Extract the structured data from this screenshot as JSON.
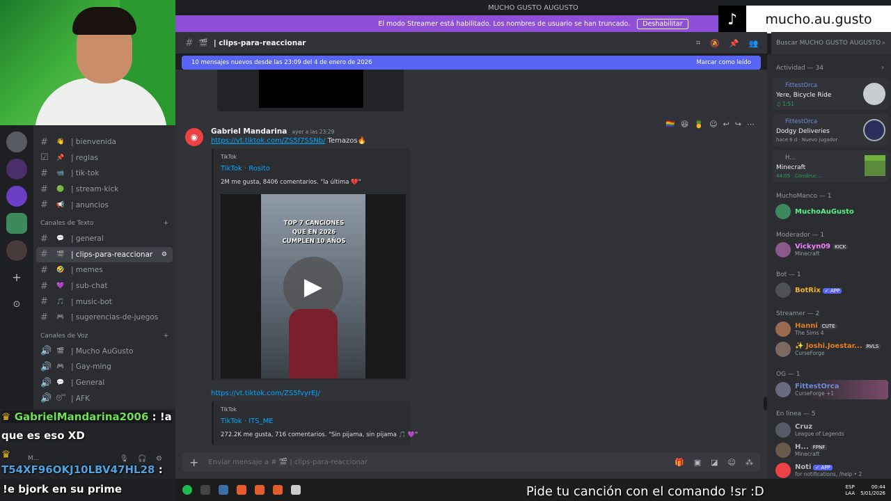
{
  "window": {
    "title": "MUCHO GUSTO AUGUSTO"
  },
  "streamer_banner": {
    "text": "El modo Streamer está habilitado. Los nombres de usuario se han truncado.",
    "button": "Deshabilitar"
  },
  "tiktok_overlay": {
    "handle": "mucho.au.gusto"
  },
  "channel_header": {
    "name": "| clips-para-reaccionar",
    "search_placeholder": "Buscar MUCHO GUSTO AUGUSTO"
  },
  "new_messages_bar": {
    "text": "10 mensajes nuevos desde las 23:09 del 4 de enero de 2026",
    "action": "Marcar como leído"
  },
  "sidebar": {
    "top_channels": [
      {
        "label": "| bienvenida",
        "emoji": "👋"
      },
      {
        "label": "| reglas",
        "emoji": "📌"
      },
      {
        "label": "| tik-tok",
        "emoji": "📹"
      },
      {
        "label": "| stream-kick",
        "emoji": "🟢"
      },
      {
        "label": "| anuncios",
        "emoji": "📢"
      }
    ],
    "text_category": "Canales de Texto",
    "text_channels": [
      {
        "label": "| general",
        "emoji": "💬"
      },
      {
        "label": "| clips-para-reaccionar",
        "emoji": "🎬"
      },
      {
        "label": "| memes",
        "emoji": "🤣"
      },
      {
        "label": "| sub-chat",
        "emoji": "💜"
      },
      {
        "label": "| music-bot",
        "emoji": "🎵"
      },
      {
        "label": "| sugerencias-de-juegos",
        "emoji": "🎮"
      }
    ],
    "voice_category": "Canales de Voz",
    "voice_channels": [
      {
        "label": "| Mucho AuGusto",
        "emoji": "🎬"
      },
      {
        "label": "| Gay-ming",
        "emoji": "🎮"
      },
      {
        "label": "| General",
        "emoji": "💬"
      },
      {
        "label": "| AFK",
        "emoji": "😴"
      }
    ],
    "user_short": "M..."
  },
  "stream_chat": {
    "line1_user": "GabrielMandarina2006",
    "line1_text": ": !a",
    "line1_cont": "que es eso XD",
    "line2_user": "T54XF96OKJ10LBV47HL28",
    "line2_text": ":",
    "line3_text": "!e bjork en su prime"
  },
  "message": {
    "author": "Gabriel Mandarina",
    "time": "ayer a las 23:29",
    "link": "https://vt.tiktok.com/ZS5f7SSNb/",
    "text": "Temazos🔥",
    "embed1": {
      "provider": "TikTok",
      "title": "TikTok · Rosito",
      "desc": "2M me gusta, 8406 comentarios. \"la última 💔\"",
      "video_caption": "TOP 7 CANCIONES QUE EN 2026 CUMPLEN 10 AÑOS"
    },
    "link2": "https://vt.tiktok.com/ZS5fvyrEJ/",
    "embed2": {
      "provider": "TikTok",
      "title": "TikTok · ITS_ME",
      "desc": "272.2K me gusta, 716 comentarios. \"Sin pijama, sin pijama 🎵 💜\""
    }
  },
  "composer": {
    "placeholder": "Enviar mensaje a # 🎬 | clips-para-reaccionar"
  },
  "members": {
    "activity_header": "Actividad — 34",
    "activities": [
      {
        "user": "FittestOrca",
        "title": "Yere, Bicycle Ride",
        "sub": "♫ 1:51"
      },
      {
        "user": "FittestOrca",
        "title": "Dodgy Deliveries",
        "sub": "hace 6 d · Nuevo jugador"
      },
      {
        "user": "H...",
        "title": "Minecraft",
        "sub": "44:05 · Construc..."
      }
    ],
    "groups": [
      {
        "label": "MuchoManco — 1"
      },
      {
        "label": "Moderador — 1"
      },
      {
        "label": "Bot — 1"
      },
      {
        "label": "Streamer — 2"
      },
      {
        "label": "OG — 1"
      },
      {
        "label": "En línea — 5"
      }
    ],
    "list": [
      {
        "name": "MuchoAuGusto",
        "sub": "",
        "badge": "",
        "color": "#57f287"
      },
      {
        "name": "Vickyn09",
        "sub": "Minecraft",
        "badge": "KICK",
        "color": "#f47fff"
      },
      {
        "name": "BotRix",
        "sub": "",
        "badge": "✓ APP",
        "color": "#f0b232"
      },
      {
        "name": "Hanni",
        "sub": "The Sims 4",
        "badge": "CUTE",
        "color": "#e67e22"
      },
      {
        "name": "✨ Joshi.Joestar...",
        "sub": "CurseForge",
        "badge": "RVLS",
        "color": "#e67e22"
      },
      {
        "name": "FittestOrca",
        "sub": "CurseForge +1",
        "badge": "",
        "color": "#7289da"
      },
      {
        "name": "Cruz",
        "sub": "League of Legends",
        "badge": "",
        "color": "#b5bac1"
      },
      {
        "name": "H...",
        "sub": "Minecraft",
        "badge": "FPNF",
        "color": "#b5bac1"
      },
      {
        "name": "Noti",
        "sub": "for notifications, /help • 2",
        "badge": "✓ APP",
        "color": "#b5bac1"
      }
    ]
  },
  "overlay_bottom": {
    "text": "Pide tu canción con el comando !sr :D"
  },
  "tray": {
    "lang": "ESP",
    "lang2": "LAA",
    "time": "00:44",
    "date": "5/01/2026"
  }
}
